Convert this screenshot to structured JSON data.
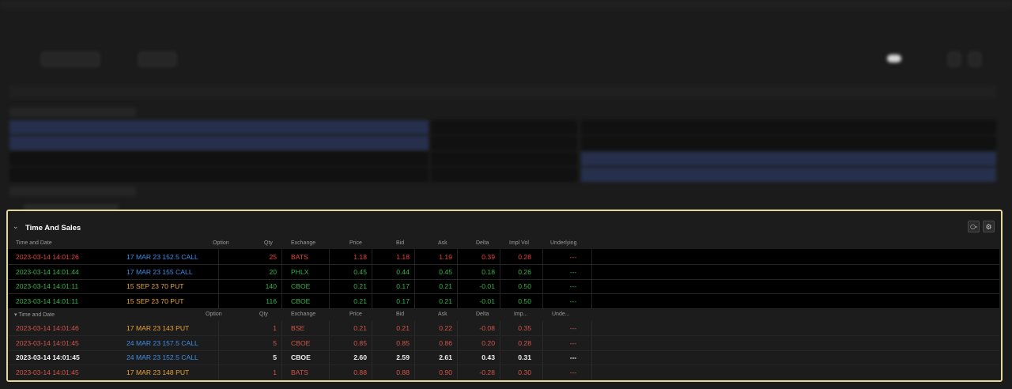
{
  "panel": {
    "title": "Time And Sales",
    "icons": [
      "chevron-down-icon",
      "link-icon",
      "gear-icon"
    ]
  },
  "table1": {
    "headers": [
      "Time and Date",
      "Option",
      "Qty",
      "Exchange",
      "Price",
      "Bid",
      "Ask",
      "Delta",
      "Impl Vol",
      "Underlying"
    ],
    "rows": [
      {
        "time": "2023-03-14 14:01:26",
        "option": "17 MAR 23 152.5 CALL",
        "qty": "25",
        "exch": "BATS",
        "price": "1.18",
        "bid": "1.18",
        "ask": "1.19",
        "delta": "0.39",
        "iv": "0.28",
        "und": "---",
        "color": "#e0453c",
        "optColor": "#3d8ee6"
      },
      {
        "time": "2023-03-14 14:01:44",
        "option": "17 MAR 23 155 CALL",
        "qty": "20",
        "exch": "PHLX",
        "price": "0.45",
        "bid": "0.44",
        "ask": "0.45",
        "delta": "0.18",
        "iv": "0.26",
        "und": "---",
        "color": "#35b54a",
        "optColor": "#3d8ee6"
      },
      {
        "time": "2023-03-14 14:01:11",
        "option": "15 SEP 23 70 PUT",
        "qty": "140",
        "exch": "CBOE",
        "price": "0.21",
        "bid": "0.17",
        "ask": "0.21",
        "delta": "-0.01",
        "iv": "0.50",
        "und": "---",
        "color": "#35b54a",
        "optColor": "#e8a33a"
      },
      {
        "time": "2023-03-14 14:01:11",
        "option": "15 SEP 23 70 PUT",
        "qty": "116",
        "exch": "CBOE",
        "price": "0.21",
        "bid": "0.17",
        "ask": "0.21",
        "delta": "-0.01",
        "iv": "0.50",
        "und": "---",
        "color": "#35b54a",
        "optColor": "#e8a33a"
      }
    ]
  },
  "table2": {
    "headers": [
      "Time and Date",
      "Option",
      "Qty",
      "Exchange",
      "Price",
      "Bid",
      "Ask",
      "Delta",
      "Imp...",
      "Unde..."
    ],
    "rows": [
      {
        "time": "2023-03-14 14:01:46",
        "option": "17 MAR 23 143 PUT",
        "qty": "1",
        "exch": "BSE",
        "price": "0.21",
        "bid": "0.21",
        "ask": "0.22",
        "delta": "-0.08",
        "iv": "0.35",
        "und": "---",
        "color": "#d2554a",
        "optColor": "#e8a33a"
      },
      {
        "time": "2023-03-14 14:01:45",
        "option": "24 MAR 23 157.5 CALL",
        "qty": "5",
        "exch": "CBOE",
        "price": "0.85",
        "bid": "0.85",
        "ask": "0.86",
        "delta": "0.20",
        "iv": "0.28",
        "und": "---",
        "color": "#d2554a",
        "optColor": "#3d8ee6"
      },
      {
        "time": "2023-03-14 14:01:45",
        "option": "24 MAR 23 152.5 CALL",
        "qty": "5",
        "exch": "CBOE",
        "price": "2.60",
        "bid": "2.59",
        "ask": "2.61",
        "delta": "0.43",
        "iv": "0.31",
        "und": "---",
        "color": "#f0f0f0",
        "optColor": "#3d8ee6"
      },
      {
        "time": "2023-03-14 14:01:45",
        "option": "17 MAR 23 148 PUT",
        "qty": "1",
        "exch": "BATS",
        "price": "0.88",
        "bid": "0.88",
        "ask": "0.90",
        "delta": "-0.28",
        "iv": "0.30",
        "und": "---",
        "color": "#d2554a",
        "optColor": "#e8a33a"
      }
    ]
  }
}
